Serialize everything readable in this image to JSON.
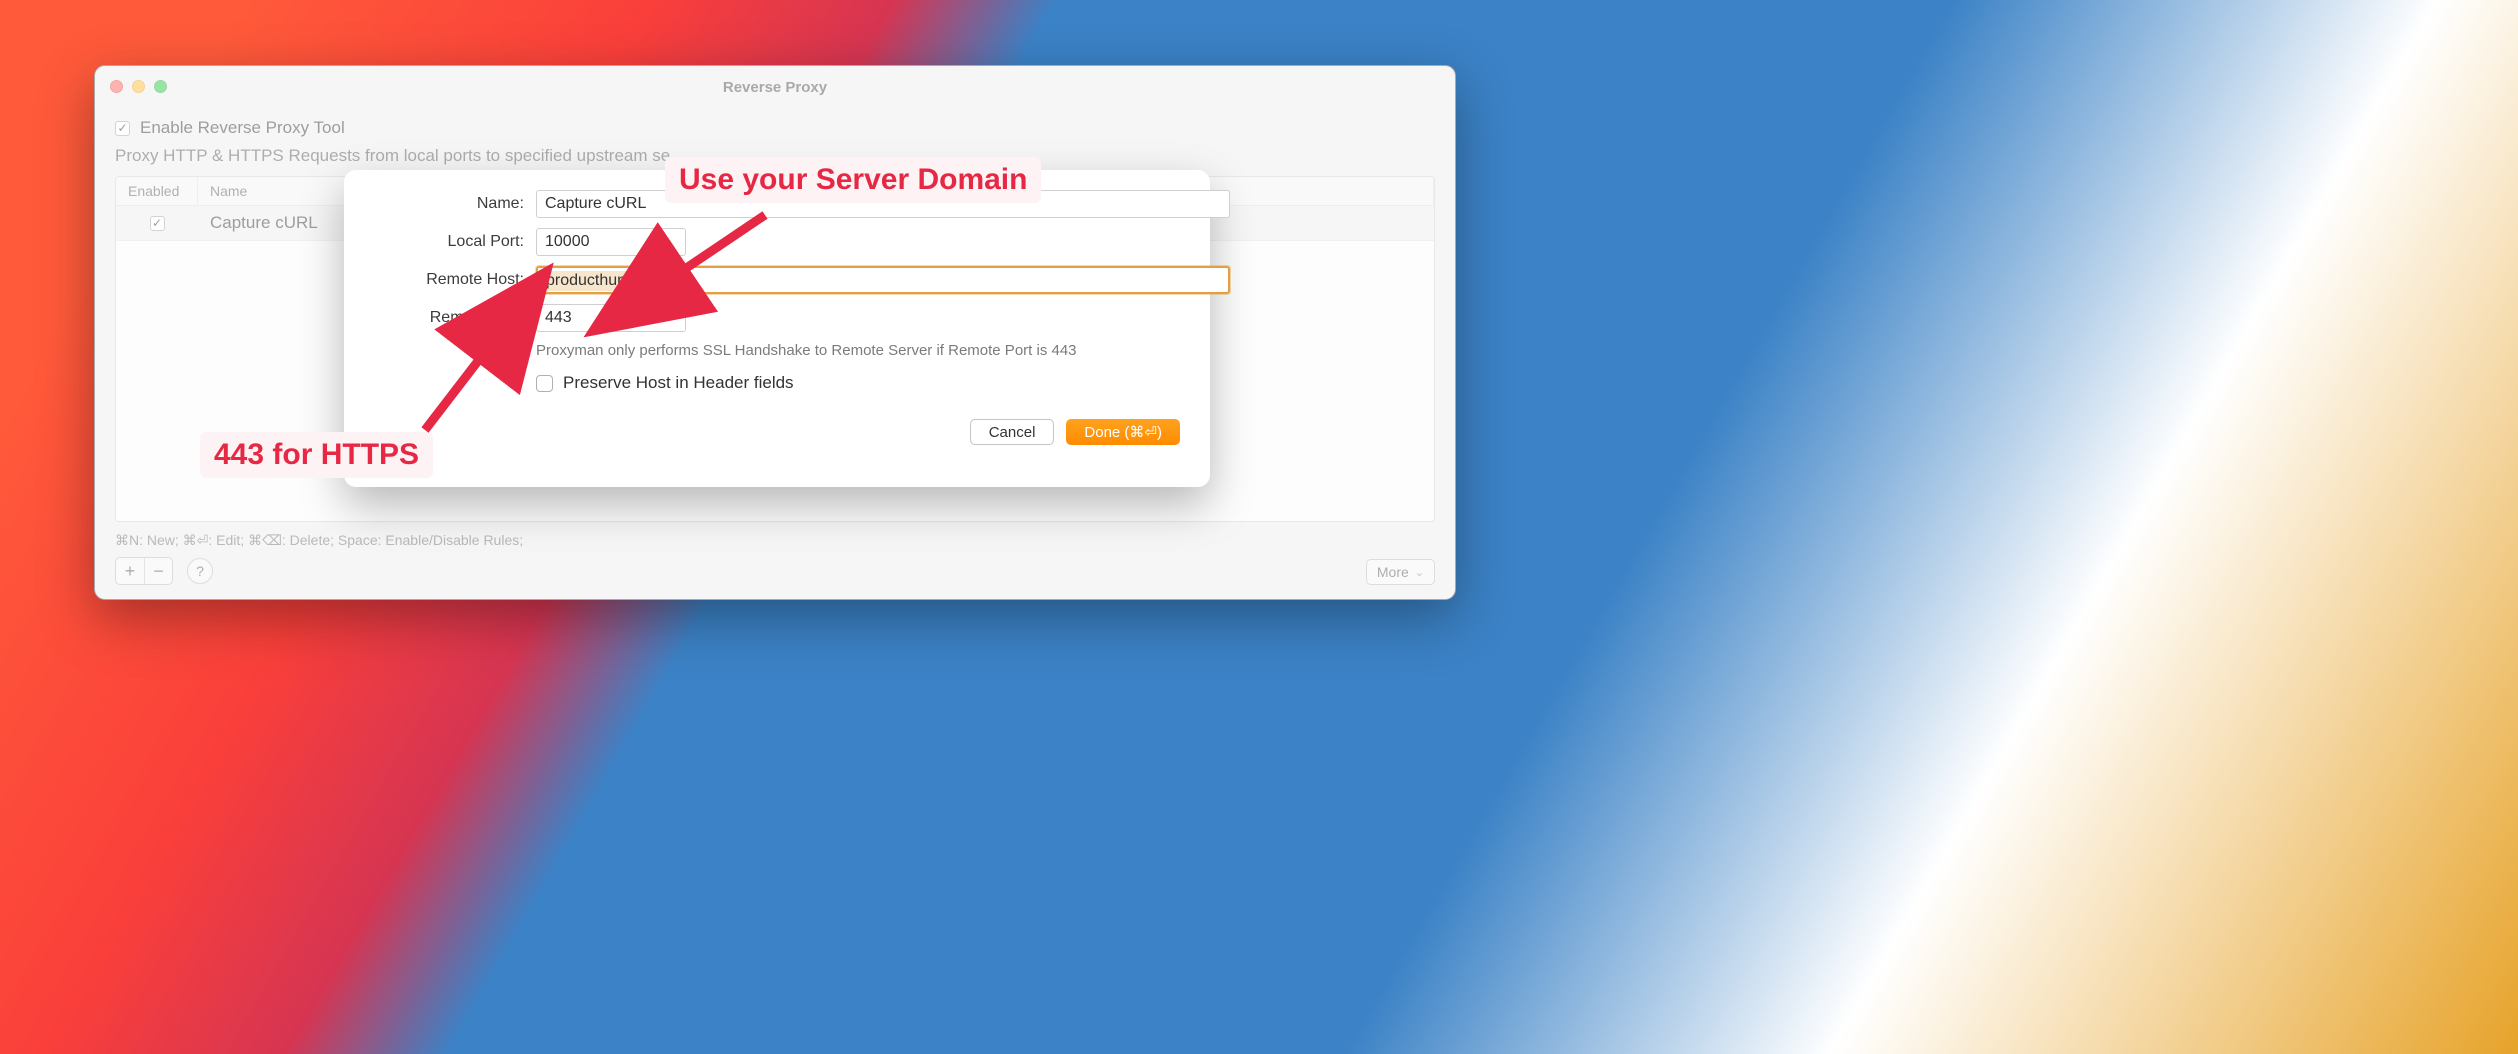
{
  "window": {
    "title": "Reverse Proxy",
    "enable_label": "Enable Reverse Proxy Tool",
    "enable_checked": true,
    "description": "Proxy HTTP & HTTPS Requests from local ports to specified upstream se",
    "columns": {
      "enabled": "Enabled",
      "name": "Name"
    },
    "rows": [
      {
        "enabled": true,
        "name": "Capture cURL"
      }
    ],
    "shortcuts": "⌘N: New; ⌘⏎: Edit; ⌘⌫: Delete; Space: Enable/Disable Rules;",
    "more": "More"
  },
  "sheet": {
    "labels": {
      "name": "Name:",
      "local_port": "Local Port:",
      "remote_host": "Remote Host:",
      "remote_port": "Remote Port:"
    },
    "values": {
      "name": "Capture cURL",
      "local_port": "10000",
      "remote_host": "producthunt.com",
      "remote_port": "443"
    },
    "hint": "Proxyman only performs SSL Handshake to Remote Server if Remote Port is 443",
    "preserve_label": "Preserve Host in Header fields",
    "preserve_checked": false,
    "buttons": {
      "cancel": "Cancel",
      "done": "Done (⌘⏎)"
    }
  },
  "annotations": {
    "server_domain": "Use your Server Domain",
    "https_port": "443 for HTTPS"
  }
}
